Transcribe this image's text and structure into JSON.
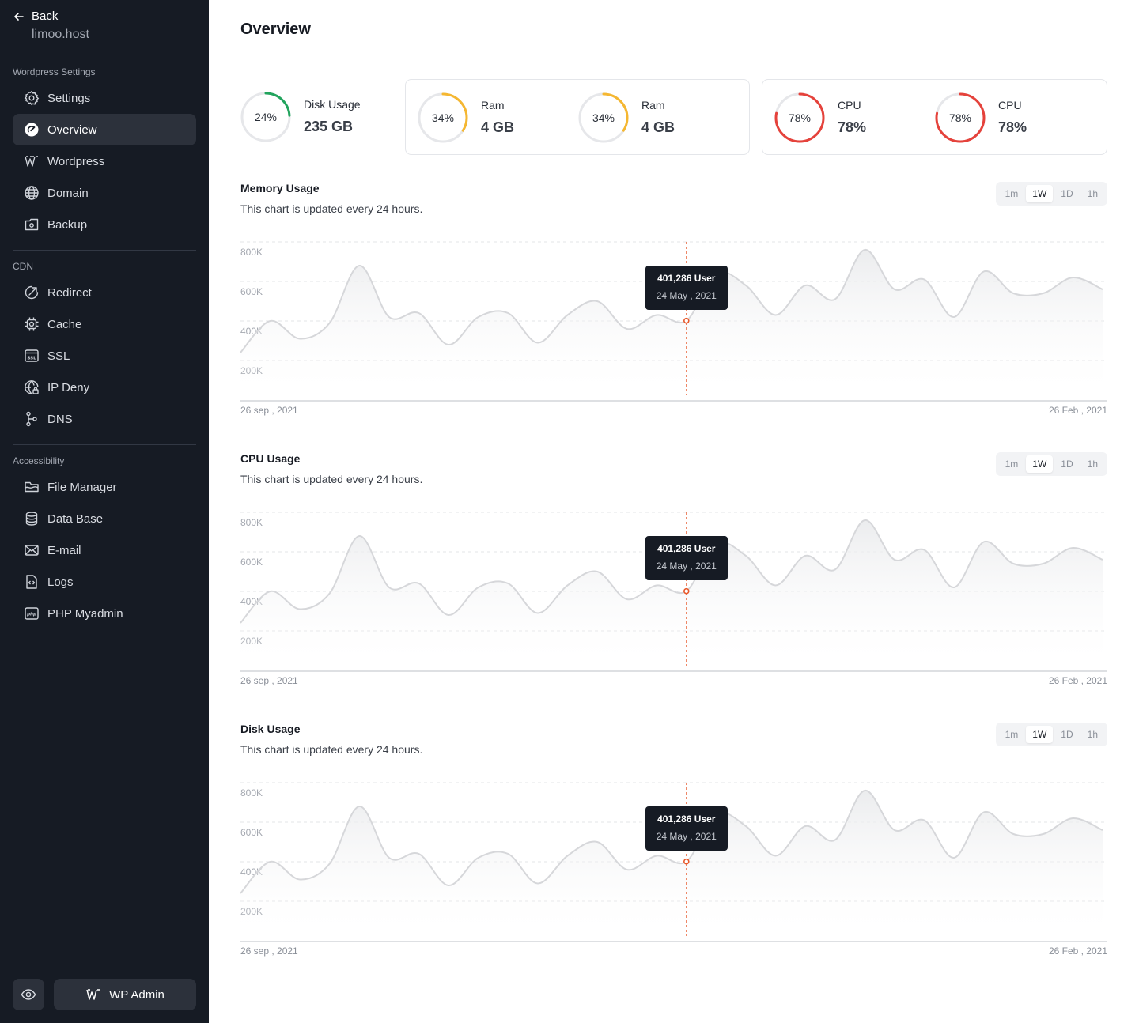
{
  "sidebar": {
    "back_label": "Back",
    "host": "limoo.host",
    "sections": [
      {
        "label": "Wordpress Settings",
        "items": [
          {
            "label": "Settings",
            "icon": "gear-icon",
            "active": false
          },
          {
            "label": "Overview",
            "icon": "gauge-icon",
            "active": true
          },
          {
            "label": "Wordpress",
            "icon": "wordpress-icon",
            "active": false
          },
          {
            "label": "Domain",
            "icon": "globe-icon",
            "active": false
          },
          {
            "label": "Backup",
            "icon": "backup-icon",
            "active": false
          }
        ]
      },
      {
        "label": "CDN",
        "items": [
          {
            "label": "Redirect",
            "icon": "redirect-icon",
            "active": false
          },
          {
            "label": "Cache",
            "icon": "chip-icon",
            "active": false
          },
          {
            "label": "SSL",
            "icon": "ssl-icon",
            "active": false
          },
          {
            "label": "IP Deny",
            "icon": "globe-lock-icon",
            "active": false
          },
          {
            "label": "DNS",
            "icon": "dns-icon",
            "active": false
          }
        ]
      },
      {
        "label": "Accessibility",
        "items": [
          {
            "label": "File Manager",
            "icon": "folder-icon",
            "active": false
          },
          {
            "label": "Data Base",
            "icon": "database-icon",
            "active": false
          },
          {
            "label": "E-mail",
            "icon": "mail-icon",
            "active": false
          },
          {
            "label": "Logs",
            "icon": "file-code-icon",
            "active": false
          },
          {
            "label": "PHP Myadmin",
            "icon": "php-icon",
            "active": false
          }
        ]
      }
    ],
    "wp_admin_label": "WP Admin"
  },
  "main": {
    "title": "Overview",
    "stats": [
      {
        "label": "Disk Usage",
        "value": "235 GB",
        "percent_text": "24%",
        "percent": 24,
        "color": "#22a45d"
      },
      {
        "label": "Ram",
        "value": "4 GB",
        "percent_text": "34%",
        "percent": 34,
        "color": "#f5b731"
      },
      {
        "label": "Ram",
        "value": "4 GB",
        "percent_text": "34%",
        "percent": 34,
        "color": "#f5b731"
      },
      {
        "label": "CPU",
        "value": "78%",
        "percent_text": "78%",
        "percent": 78,
        "color": "#e5423b"
      },
      {
        "label": "CPU",
        "value": "78%",
        "percent_text": "78%",
        "percent": 78,
        "color": "#e5423b"
      }
    ],
    "charts": [
      {
        "title": "Memory Usage",
        "subtitle": "This chart is updated every 24 hours.",
        "tabs": [
          "1m",
          "1W",
          "1D",
          "1h"
        ],
        "active_tab": "1W",
        "y_ticks": [
          "800K",
          "600K",
          "400K",
          "200K"
        ],
        "x_start": "26 sep , 2021",
        "x_end": "26 Feb , 2021",
        "tooltip": {
          "value": "401,286 User",
          "date": "24 May , 2021"
        }
      },
      {
        "title": "CPU Usage",
        "subtitle": "This chart is updated every 24 hours.",
        "tabs": [
          "1m",
          "1W",
          "1D",
          "1h"
        ],
        "active_tab": "1W",
        "y_ticks": [
          "800K",
          "600K",
          "400K",
          "200K"
        ],
        "x_start": "26 sep , 2021",
        "x_end": "26 Feb , 2021",
        "tooltip": {
          "value": "401,286 User",
          "date": "24 May , 2021"
        }
      },
      {
        "title": "Disk Usage",
        "subtitle": "This chart is updated every 24 hours.",
        "tabs": [
          "1m",
          "1W",
          "1D",
          "1h"
        ],
        "active_tab": "1W",
        "y_ticks": [
          "800K",
          "600K",
          "400K",
          "200K"
        ],
        "x_start": "26 sep , 2021",
        "x_end": "26 Feb , 2021",
        "tooltip": {
          "value": "401,286 User",
          "date": "24 May , 2021"
        }
      }
    ]
  },
  "colors": {
    "sidebar_bg": "#161b24",
    "active_item_bg": "#2c313b",
    "marker": "#e8582a",
    "disk": "#22a45d",
    "ram": "#f5b731",
    "cpu": "#e5423b"
  },
  "chart_data": [
    {
      "type": "area",
      "title": "Memory Usage",
      "ylim": [
        0,
        800000
      ],
      "y_ticks": [
        200000,
        400000,
        600000,
        800000
      ],
      "values": [
        240000,
        400000,
        310000,
        390000,
        680000,
        420000,
        440000,
        280000,
        420000,
        440000,
        290000,
        430000,
        500000,
        360000,
        430000,
        401286,
        640000,
        580000,
        430000,
        580000,
        510000,
        760000,
        560000,
        610000,
        420000,
        650000,
        540000,
        540000,
        620000,
        560000
      ],
      "highlight": {
        "index": 15,
        "value": 401286,
        "label": "401,286 User",
        "date": "24 May , 2021"
      }
    },
    {
      "type": "area",
      "title": "CPU Usage",
      "ylim": [
        0,
        800000
      ],
      "y_ticks": [
        200000,
        400000,
        600000,
        800000
      ],
      "values": [
        240000,
        400000,
        310000,
        390000,
        680000,
        420000,
        440000,
        280000,
        420000,
        440000,
        290000,
        430000,
        500000,
        360000,
        430000,
        401286,
        640000,
        580000,
        430000,
        580000,
        510000,
        760000,
        560000,
        610000,
        420000,
        650000,
        540000,
        540000,
        620000,
        560000
      ],
      "highlight": {
        "index": 15,
        "value": 401286,
        "label": "401,286 User",
        "date": "24 May , 2021"
      }
    },
    {
      "type": "area",
      "title": "Disk Usage",
      "ylim": [
        0,
        800000
      ],
      "y_ticks": [
        200000,
        400000,
        600000,
        800000
      ],
      "values": [
        240000,
        400000,
        310000,
        390000,
        680000,
        420000,
        440000,
        280000,
        420000,
        440000,
        290000,
        430000,
        500000,
        360000,
        430000,
        401286,
        640000,
        580000,
        430000,
        580000,
        510000,
        760000,
        560000,
        610000,
        420000,
        650000,
        540000,
        540000,
        620000,
        560000
      ],
      "highlight": {
        "index": 15,
        "value": 401286,
        "label": "401,286 User",
        "date": "24 May , 2021"
      }
    }
  ]
}
